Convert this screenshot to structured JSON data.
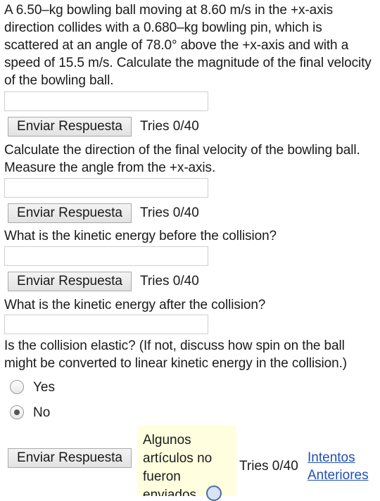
{
  "q1": {
    "text": "A 6.50–kg bowling ball moving at 8.60 m/s in the +x-axis direction collides with a 0.680–kg bowling pin, which is scattered at an angle of 78.0° above the +x-axis and with a speed of 15.5 m/s. Calculate the magnitude of the final velocity of the bowling ball.",
    "input_value": "",
    "submit_label": "Enviar Respuesta",
    "tries": "Tries 0/40"
  },
  "q2": {
    "text": "Calculate the direction of the final velocity of the bowling ball. Measure the angle from the +x-axis.",
    "input_value": "",
    "submit_label": "Enviar Respuesta",
    "tries": "Tries 0/40"
  },
  "q3": {
    "text": "What is the kinetic energy before the collision?",
    "input_value": "",
    "submit_label": "Enviar Respuesta",
    "tries": "Tries 0/40"
  },
  "q4": {
    "text": "What is the kinetic energy after the collision?",
    "input_value": ""
  },
  "q5": {
    "text": "Is the collision elastic? (If not, discuss how spin on the ball might be converted to linear kinetic energy in the collision.)",
    "options": [
      {
        "label": "Yes",
        "selected": false
      },
      {
        "label": "No",
        "selected": true
      }
    ],
    "submit_label": "Enviar Respuesta",
    "note": "Algunos artículos no fueron enviados",
    "tries": "Tries 0/40",
    "previous_link": "Intentos Anteriores"
  }
}
